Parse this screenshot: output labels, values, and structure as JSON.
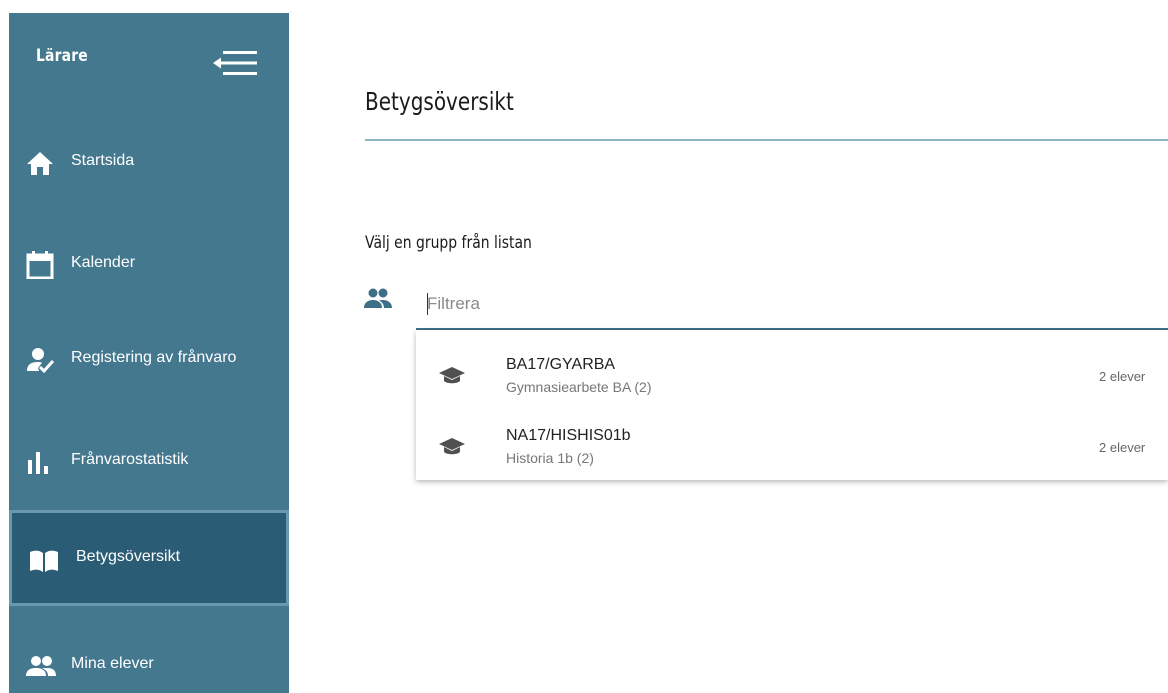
{
  "sidebar": {
    "title": "Lärare",
    "items": [
      {
        "label": "Startsida",
        "icon": "home-icon"
      },
      {
        "label": "Kalender",
        "icon": "calendar-icon"
      },
      {
        "label": "Registering av frånvaro",
        "icon": "person-check-icon"
      },
      {
        "label": "Frånvarostatistik",
        "icon": "bar-chart-icon"
      },
      {
        "label": "Betygsöversikt",
        "icon": "book-icon",
        "active": true
      },
      {
        "label": "Mina elever",
        "icon": "people-icon"
      }
    ]
  },
  "main": {
    "title": "Betygsöversikt",
    "section_label": "Välj en grupp från listan",
    "filter": {
      "placeholder": "Filtrera",
      "value": ""
    },
    "groups": [
      {
        "code": "BA17/GYARBA",
        "name": "Gymnasiearbete BA (2)",
        "count": "2 elever"
      },
      {
        "code": "NA17/HISHIS01b",
        "name": "Historia 1b (2)",
        "count": "2 elever"
      }
    ]
  },
  "colors": {
    "sidebar_bg": "#44788f",
    "sidebar_active_bg": "#2b5c75",
    "accent_line": "#8fb6c8",
    "icon_teal": "#3d6f87"
  }
}
